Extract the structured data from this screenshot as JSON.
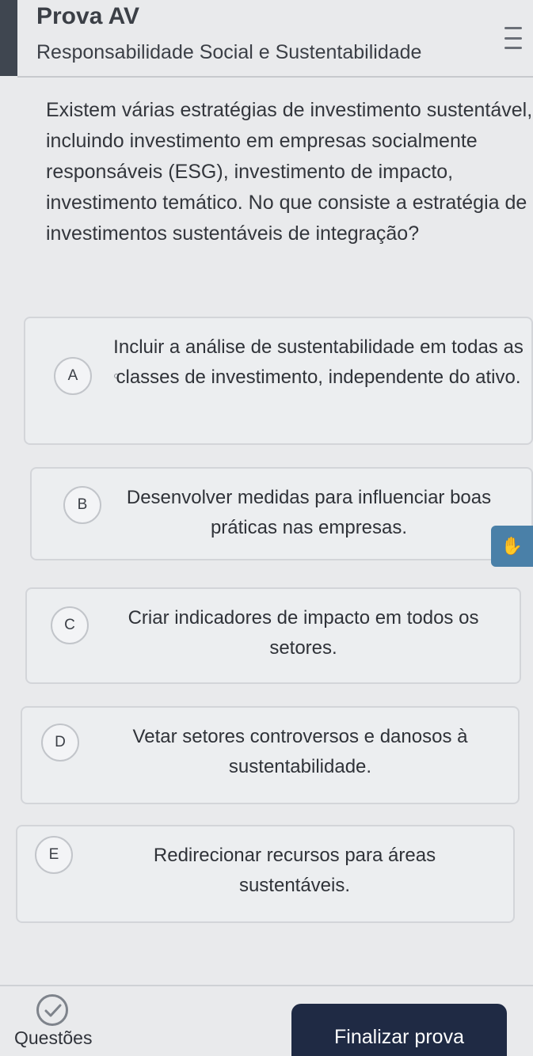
{
  "header": {
    "title": "Prova AV",
    "subtitle": "Responsabilidade Social e Sustentabilidade",
    "menu_icon": "hamburger-menu-icon"
  },
  "question": {
    "text": "Existem várias estratégias de investimento sustentável, incluindo investimento em empresas socialmente responsáveis (ESG), investimento de impacto, investimento temático. No que consiste a estratégia de investimentos sustentáveis de integração?"
  },
  "options": [
    {
      "letter": "A",
      "text": "Incluir a análise de sustentabilidade em todas as classes de investimento, independente do ativo."
    },
    {
      "letter": "B",
      "text": "Desenvolver medidas para influenciar boas práticas nas empresas."
    },
    {
      "letter": "C",
      "text": "Criar indicadores de impacto em todos os setores."
    },
    {
      "letter": "D",
      "text": "Vetar setores controversos e danosos à sustentabilidade."
    },
    {
      "letter": "E",
      "text": "Redirecionar recursos para áreas sustentáveis."
    }
  ],
  "footer": {
    "questions_label": "Questões",
    "finish_label": "Finalizar prova",
    "check_icon": "check-circle-icon"
  },
  "colors": {
    "primary_button": "#1f2a44",
    "accent_badge": "#4a80a8"
  }
}
